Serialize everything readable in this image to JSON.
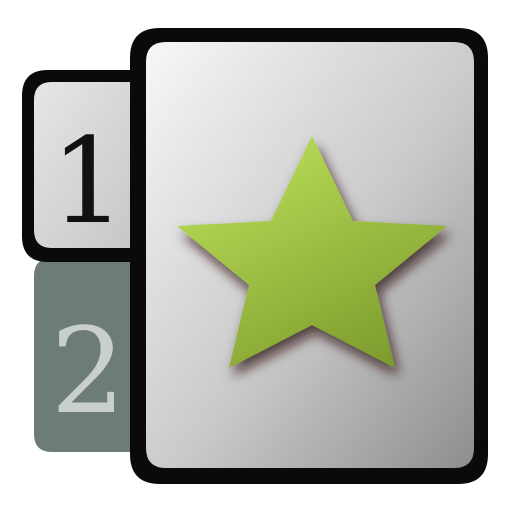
{
  "icon": {
    "semantic": "favorite-pages-icon",
    "tab_one_label": "1",
    "tab_two_label": "2",
    "star_icon": "star-icon",
    "colors": {
      "outline": "#0a0a0a",
      "tab_one_fill": "#d8d8d8",
      "tab_two_fill": "#6f7d7a",
      "tab_one_text": "#111111",
      "tab_two_text": "#c9cfcd",
      "page_light": "#f4f4f4",
      "page_dark": "#9a9a9a",
      "star_light": "#b5dc4e",
      "star_dark": "#7f9e2e"
    }
  }
}
